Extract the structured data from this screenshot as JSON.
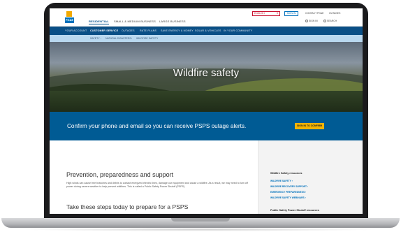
{
  "logo": {
    "text": "PG&E"
  },
  "segments": [
    "RESIDENTIAL",
    "SMALL & MEDIUM BUSINESS",
    "LARGE BUSINESS"
  ],
  "utility": {
    "language": "ENGLISH",
    "signin_pill": "SIGN IN",
    "contact": "CONTACT PG&E",
    "outages": "OUTAGES",
    "sign_in": "SIGN IN",
    "search": "SEARCH"
  },
  "nav": [
    "YOUR ACCOUNT",
    "CUSTOMER SERVICE",
    "OUTAGES",
    "RATE PLANS",
    "SAVE ENERGY & MONEY",
    "SOLAR & VEHICLES",
    "IN YOUR COMMUNITY"
  ],
  "breadcrumbs": [
    "SAFETY",
    "NATURAL DISASTERS",
    "WILDFIRE SAFETY"
  ],
  "hero": {
    "title": "Wildfire safety"
  },
  "banner": {
    "message": "Confirm your phone and email so you can receive PSPS outage alerts.",
    "button": "SIGN IN TO CONFIRM"
  },
  "main": {
    "heading": "Prevention, preparedness and support",
    "body": "High winds can cause tree branches and debris to contact energized electric lines, damage our equipment and cause a wildfire. As a result, we may need to turn off power during severe weather to help prevent wildfires. This is called a Public Safety Power Shutoff (PSPS).",
    "subheading": "Take these steps today to prepare for a PSPS"
  },
  "sidebar": {
    "group1_title": "Wildfire Safety resources",
    "links": [
      "WILDFIRE SAFETY",
      "WILDFIRE RECOVERY SUPPORT",
      "EMERGENCY PREPAREDNESS",
      "WILDFIRE SAFETY WEBINARS"
    ],
    "group2_title": "Public Safety Power Shutoff resources",
    "group2_link": "FREQUENTLY ASKED QUESTIONS"
  },
  "colors": {
    "nav": "#0a4f86",
    "banner": "#005b94",
    "button": "#f2b301",
    "link": "#0071bc"
  }
}
